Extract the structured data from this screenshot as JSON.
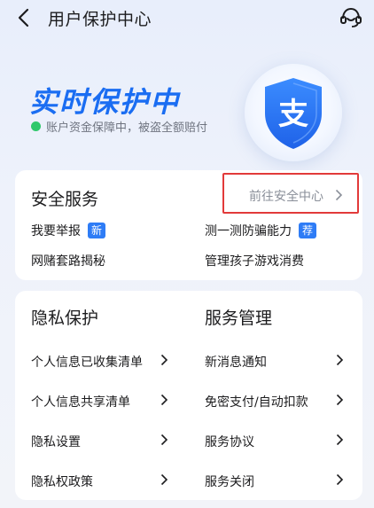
{
  "header": {
    "title": "用户保护中心",
    "back_icon": "back-arrow-icon",
    "support_icon": "customer-service-icon"
  },
  "hero": {
    "title": "实时保护中",
    "subtitle": "账户资金保障中，被盗全额赔付",
    "status_color": "#2fc86b",
    "shield_icon": "alipay-shield-icon",
    "accent": "#1a6df2"
  },
  "security": {
    "title": "安全服务",
    "link_label": "前往安全中心",
    "items": [
      {
        "label": "我要举报",
        "badge": "新"
      },
      {
        "label": "测一测防骗能力",
        "badge": "荐"
      },
      {
        "label": "网赌套路揭秘",
        "badge": ""
      },
      {
        "label": "管理孩子游戏消费",
        "badge": ""
      }
    ]
  },
  "privacy": {
    "title": "隐私保护",
    "items": [
      {
        "label": "个人信息已收集清单"
      },
      {
        "label": "个人信息共享清单"
      },
      {
        "label": "隐私设置"
      },
      {
        "label": "隐私权政策"
      }
    ]
  },
  "service_mgmt": {
    "title": "服务管理",
    "items": [
      {
        "label": "新消息通知"
      },
      {
        "label": "免密支付/自动扣款"
      },
      {
        "label": "服务协议"
      },
      {
        "label": "服务关闭"
      }
    ]
  }
}
